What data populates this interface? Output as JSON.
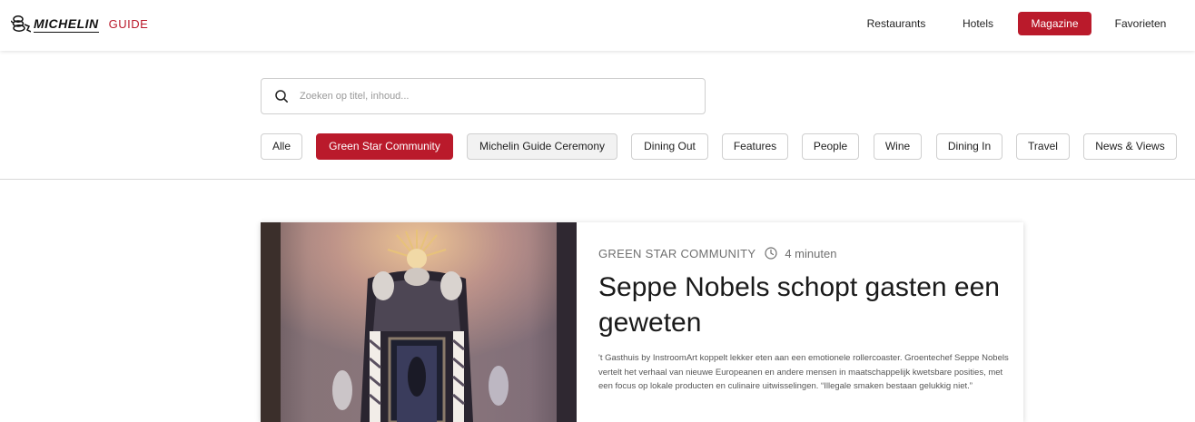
{
  "brand": {
    "wordmark": "MICHELIN",
    "guide_label": "GUIDE"
  },
  "nav": {
    "items": [
      {
        "label": "Restaurants"
      },
      {
        "label": "Hotels"
      },
      {
        "label": "Magazine",
        "active": true
      },
      {
        "label": "Favorieten"
      }
    ]
  },
  "search": {
    "placeholder": "Zoeken op titel, inhoud...",
    "value": ""
  },
  "filters": {
    "items": [
      {
        "label": "Alle"
      },
      {
        "label": "Green Star Community",
        "active": true
      },
      {
        "label": "Michelin Guide Ceremony"
      },
      {
        "label": "Dining Out"
      },
      {
        "label": "Features"
      },
      {
        "label": "People"
      },
      {
        "label": "Wine"
      },
      {
        "label": "Dining In"
      },
      {
        "label": "Travel"
      },
      {
        "label": "News & Views"
      }
    ]
  },
  "article": {
    "category": "GREEN STAR COMMUNITY",
    "read_time": "4 minuten",
    "title": "Seppe Nobels schopt gasten een geweten",
    "excerpt": "'t Gasthuis by InstroomArt koppelt lekker eten aan een emotionele rollercoaster. Groentechef Seppe Nobels vertelt het verhaal van nieuwe Europeanen en andere mensen in maatschappelijk kwetsbare posities, met een focus op lokale producten en culinaire uitwisselingen. “Illegale smaken bestaan gelukkig niet.”"
  },
  "colors": {
    "accent": "#ba1a2b",
    "text": "#222222",
    "muted": "#707070",
    "border": "#cfcfcf"
  },
  "icons": {
    "search": "search-icon",
    "clock": "clock-icon",
    "logo": "michelin-bibendum-icon"
  }
}
